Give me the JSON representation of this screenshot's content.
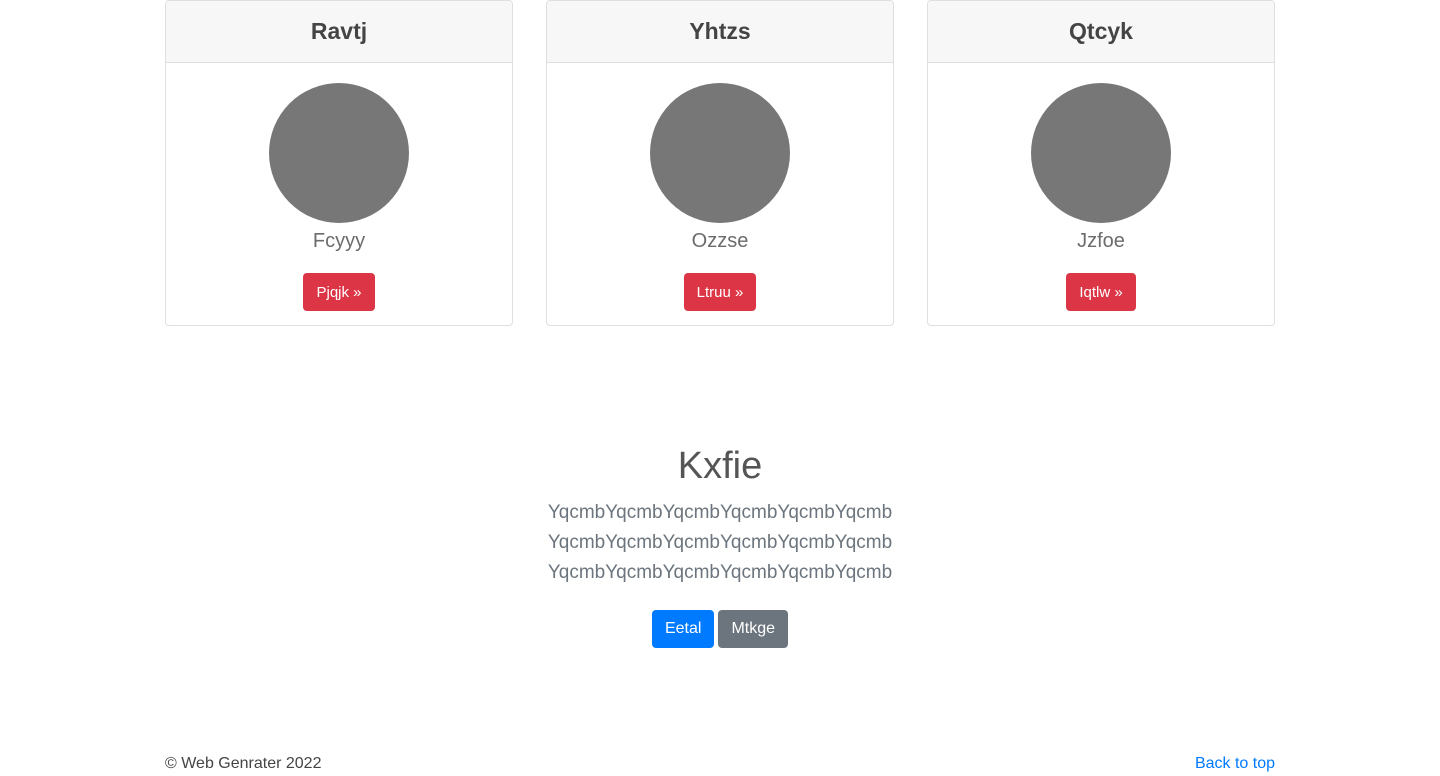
{
  "cards": [
    {
      "title": "Ravtj",
      "subtitle": "Fcyyy",
      "button_label": "Pjqjk »"
    },
    {
      "title": "Yhtzs",
      "subtitle": "Ozzse",
      "button_label": "Ltruu »"
    },
    {
      "title": "Qtcyk",
      "subtitle": "Jzfoe",
      "button_label": "Iqtlw »"
    }
  ],
  "hero": {
    "title": "Kxfie",
    "lines": [
      "YqcmbYqcmbYqcmbYqcmbYqcmbYqcmb",
      "YqcmbYqcmbYqcmbYqcmbYqcmbYqcmb",
      "YqcmbYqcmbYqcmbYqcmbYqcmbYqcmb"
    ],
    "primary_button": "Eetal",
    "secondary_button": "Mtkge"
  },
  "footer": {
    "copyright": "© Web Genrater 2022",
    "back_to_top": "Back to top"
  },
  "colors": {
    "danger": "#dc3545",
    "primary": "#007bff",
    "secondary": "#6c757d",
    "avatar": "#777777"
  }
}
